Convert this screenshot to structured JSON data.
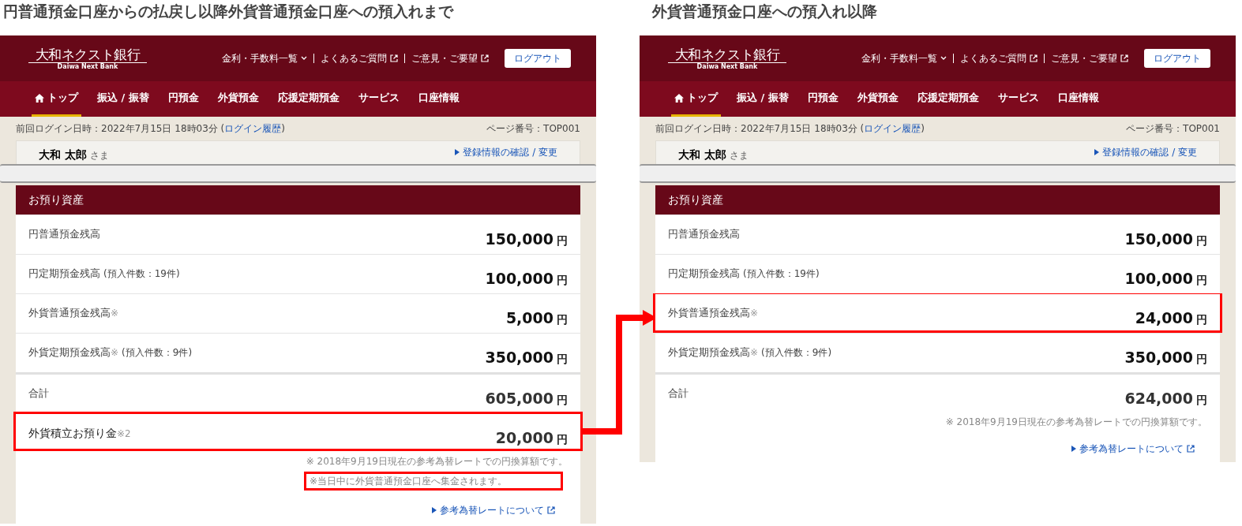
{
  "panels": [
    {
      "caption": "円普通預金口座からの払戻し以降外貨普通預金口座への預入れまで",
      "screen": {
        "logo": "大和ネクスト銀行",
        "logo_sub": "Daiwa Next Bank",
        "header_links": [
          {
            "label": "金利・手数料一覧",
            "kind": "dropdown"
          },
          {
            "label": "よくあるご質問",
            "kind": "external"
          },
          {
            "label": "ご意見・ご要望",
            "kind": "external"
          }
        ],
        "logout": "ログアウト",
        "nav": [
          {
            "label": "トップ",
            "selected": true,
            "kind": "home"
          },
          {
            "label": "振込 / 振替",
            "selected": false
          },
          {
            "label": "円預金",
            "selected": false
          },
          {
            "label": "外貨預金",
            "selected": false
          },
          {
            "label": "応援定期預金",
            "selected": false
          },
          {
            "label": "サービス",
            "selected": false
          },
          {
            "label": "口座情報",
            "selected": false
          }
        ],
        "last_login": "前回ログイン日時：2022年7月15日 18時03分 (",
        "last_login_link": "ログイン履歴",
        "last_login_end": ")",
        "page_number": "ページ番号：TOP001",
        "user_name": "大和 太郎",
        "honorific": "さま",
        "profile_link": "登録情報の確認 / 変更",
        "assets_title": "お預り資産",
        "rows": [
          {
            "kind": "balance",
            "label": "円普通預金残高",
            "amount": "150,000",
            "unit": "円",
            "highlighted": false
          },
          {
            "kind": "balance",
            "label": "円定期預金残高",
            "qualifier": "(預入件数：19件)",
            "amount": "100,000",
            "unit": "円",
            "highlighted": false
          },
          {
            "kind": "balance",
            "label": "外貨普通預金残高",
            "mark": "※",
            "amount": "5,000",
            "unit": "円",
            "highlighted": false
          },
          {
            "kind": "balance",
            "label": "外貨定期預金残高",
            "mark": "※",
            "qualifier": "(預入件数：9件)",
            "amount": "350,000",
            "unit": "円",
            "highlighted": false
          },
          {
            "kind": "total",
            "label": "合計",
            "amount": "605,000",
            "unit": "円",
            "highlighted": false
          },
          {
            "kind": "deposit",
            "label": "外貨積立お預り金",
            "mark": "※2",
            "amount": "20,000",
            "unit": "円",
            "highlighted": true
          }
        ],
        "notes": [
          {
            "text": "※ 2018年9月19日現在の参考為替レートでの円換算額です。",
            "highlighted": false
          },
          {
            "text": "※当日中に外貨普通預金口座へ集金されます。",
            "highlighted": true
          }
        ],
        "rate_link": "参考為替レートについて"
      }
    },
    {
      "caption": "外貨普通預金口座への預入れ以降",
      "screen": {
        "logo": "大和ネクスト銀行",
        "logo_sub": "Daiwa Next Bank",
        "header_links": [
          {
            "label": "金利・手数料一覧",
            "kind": "dropdown"
          },
          {
            "label": "よくあるご質問",
            "kind": "external"
          },
          {
            "label": "ご意見・ご要望",
            "kind": "external"
          }
        ],
        "logout": "ログアウト",
        "nav": [
          {
            "label": "トップ",
            "selected": true,
            "kind": "home"
          },
          {
            "label": "振込 / 振替",
            "selected": false
          },
          {
            "label": "円預金",
            "selected": false
          },
          {
            "label": "外貨預金",
            "selected": false
          },
          {
            "label": "応援定期預金",
            "selected": false
          },
          {
            "label": "サービス",
            "selected": false
          },
          {
            "label": "口座情報",
            "selected": false
          }
        ],
        "last_login": "前回ログイン日時：2022年7月15日 18時03分 (",
        "last_login_link": "ログイン履歴",
        "last_login_end": ")",
        "page_number": "ページ番号：TOP001",
        "user_name": "大和 太郎",
        "honorific": "さま",
        "profile_link": "登録情報の確認 / 変更",
        "assets_title": "お預り資産",
        "rows": [
          {
            "kind": "balance",
            "label": "円普通預金残高",
            "amount": "150,000",
            "unit": "円",
            "highlighted": false
          },
          {
            "kind": "balance",
            "label": "円定期預金残高",
            "qualifier": "(預入件数：19件)",
            "amount": "100,000",
            "unit": "円",
            "highlighted": false
          },
          {
            "kind": "balance",
            "label": "外貨普通預金残高",
            "mark": "※",
            "amount": "24,000",
            "unit": "円",
            "highlighted": true
          },
          {
            "kind": "balance",
            "label": "外貨定期預金残高",
            "mark": "※",
            "qualifier": "(預入件数：9件)",
            "amount": "350,000",
            "unit": "円",
            "highlighted": false
          },
          {
            "kind": "total",
            "label": "合計",
            "amount": "624,000",
            "unit": "円",
            "highlighted": false
          }
        ],
        "notes": [
          {
            "text": "※ 2018年9月19日現在の参考為替レートでの円換算額です。",
            "highlighted": false
          }
        ],
        "rate_link": "参考為替レートについて"
      }
    }
  ]
}
